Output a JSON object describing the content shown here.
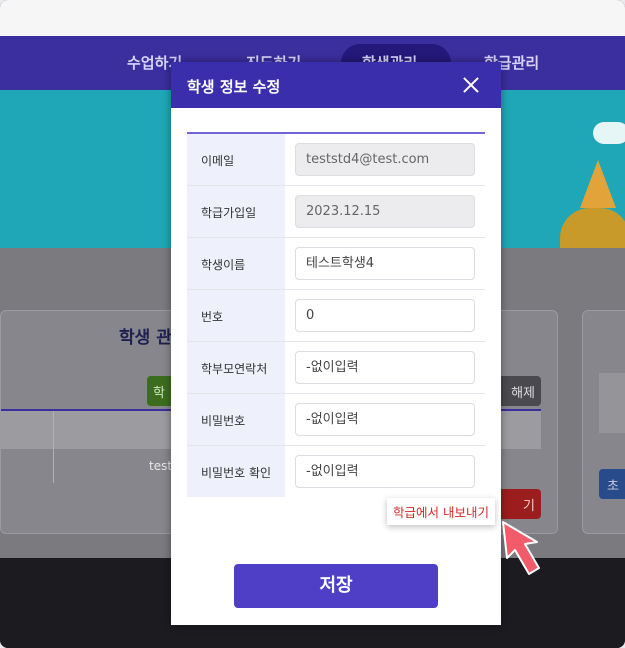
{
  "background": {
    "nav": [
      "수업하기",
      "진도하기",
      "학생관리",
      "학급관리"
    ],
    "card_title": "학생 관",
    "green_btn": "학",
    "gray_btn": "해제",
    "red_btn": "기",
    "table_text": "test",
    "blue_btn": "초"
  },
  "modal": {
    "title": "학생 정보 수정",
    "fields": [
      {
        "label": "이메일",
        "value": "teststd4@test.com",
        "readonly": true
      },
      {
        "label": "학급가입일",
        "value": "2023.12.15",
        "readonly": true
      },
      {
        "label": "학생이름",
        "value": "테스트학생4",
        "readonly": false
      },
      {
        "label": "번호",
        "value": "0",
        "readonly": false
      },
      {
        "label": "학부모연락처",
        "value": "-없이입력",
        "readonly": false
      },
      {
        "label": "비밀번호",
        "value": "-없이입력",
        "readonly": false
      },
      {
        "label": "비밀번호 확인",
        "value": "-없이입력",
        "readonly": false
      }
    ],
    "export_label": "학급에서 내보내기",
    "save_label": "저장"
  },
  "colors": {
    "header": "#3a2eac",
    "save": "#4f3ec6",
    "export": "#d42a2a",
    "cursor": "#f25b6a"
  }
}
